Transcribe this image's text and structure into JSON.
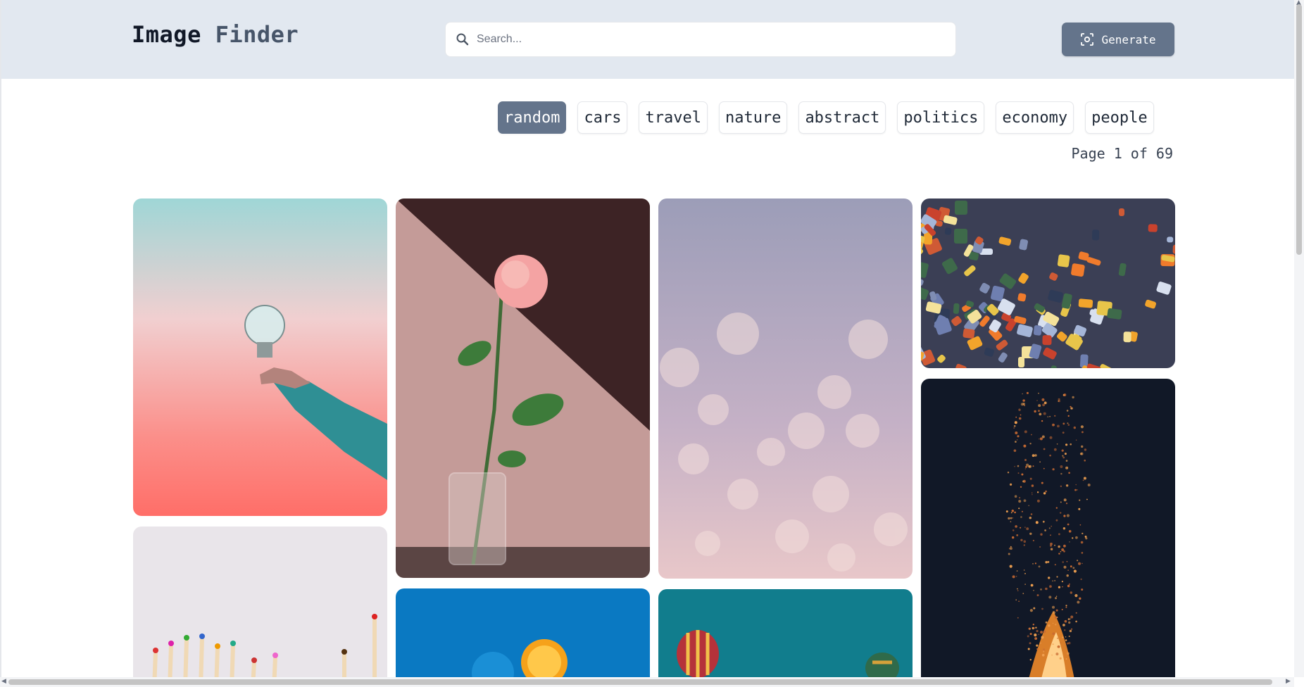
{
  "header": {
    "brand_word1": "Image",
    "brand_word2": "Finder",
    "search_placeholder": "Search...",
    "generate_label": "Generate"
  },
  "categories": [
    {
      "label": "random",
      "active": true
    },
    {
      "label": "cars",
      "active": false
    },
    {
      "label": "travel",
      "active": false
    },
    {
      "label": "nature",
      "active": false
    },
    {
      "label": "abstract",
      "active": false
    },
    {
      "label": "politics",
      "active": false
    },
    {
      "label": "economy",
      "active": false
    },
    {
      "label": "people",
      "active": false
    }
  ],
  "pagination": {
    "text": "Page 1 of 69"
  },
  "images": [
    {
      "name": "lightbulb-photo",
      "subject": "hand holding light bulb"
    },
    {
      "name": "rose-photo",
      "subject": "pink rose in glass vase"
    },
    {
      "name": "bokeh-photo",
      "subject": "bokeh lights"
    },
    {
      "name": "puzzle-photo",
      "subject": "jigsaw puzzle pieces"
    },
    {
      "name": "pencils-photo",
      "subject": "colored pencils"
    },
    {
      "name": "campfire-photo",
      "subject": "campfire sparks at night"
    },
    {
      "name": "orange-photo",
      "subject": "orange slices on blue"
    },
    {
      "name": "balloons-photo",
      "subject": "hot air balloons"
    }
  ],
  "colors": {
    "header_bg": "#e2e8f0",
    "accent": "#64748b"
  }
}
